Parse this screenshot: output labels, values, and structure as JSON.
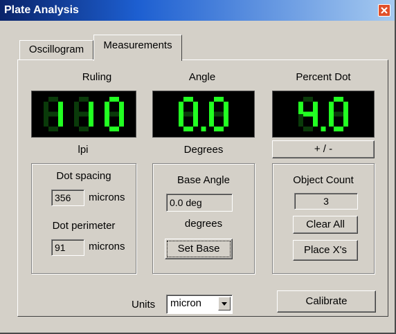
{
  "window": {
    "title": "Plate Analysis"
  },
  "tabs": [
    {
      "label": "Oscillogram"
    },
    {
      "label": "Measurements",
      "active": true
    }
  ],
  "ruling": {
    "title": "Ruling",
    "value": "110",
    "unit": "lpi"
  },
  "angle": {
    "title": "Angle",
    "value": "0.0",
    "unit": "Degrees"
  },
  "percent_dot": {
    "title": "Percent Dot",
    "value": "4.0",
    "toggle_label": "+ / -"
  },
  "dot_group": {
    "spacing_label": "Dot spacing",
    "spacing_value": "356",
    "spacing_unit": "microns",
    "perimeter_label": "Dot perimeter",
    "perimeter_value": "91",
    "perimeter_unit": "microns"
  },
  "base_group": {
    "title": "Base Angle",
    "value": "0.0 deg",
    "unit": "degrees",
    "set_label": "Set Base"
  },
  "object_group": {
    "title": "Object Count",
    "count": "3",
    "clear_label": "Clear All",
    "place_label": "Place X's"
  },
  "units": {
    "label": "Units",
    "selected": "micron"
  },
  "calibrate_label": "Calibrate",
  "colors": {
    "led_on": "#22ff22",
    "led_off": "#0a3a0a",
    "title_start": "#0a246a",
    "title_end": "#a6caf0"
  },
  "icons": {
    "close": "close-icon",
    "dropdown": "chevron-down-icon"
  }
}
